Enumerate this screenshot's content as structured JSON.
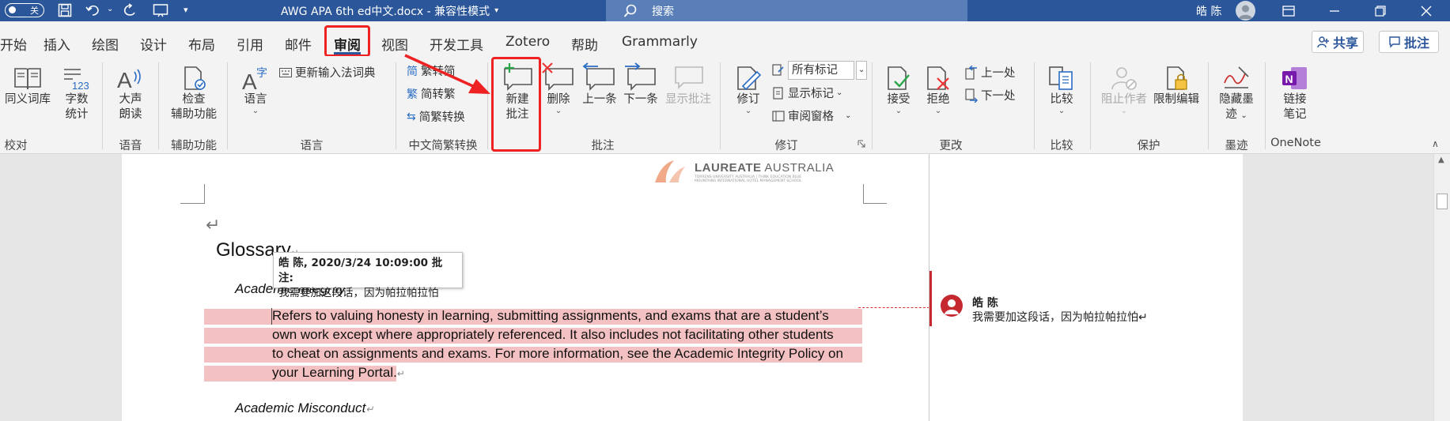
{
  "window": {
    "autosave_label": "关",
    "doc_title": "AWG APA 6th ed中文.docx  -  兼容性模式",
    "search_placeholder": "搜索",
    "user_name": "皓 陈"
  },
  "tabs": [
    "开始",
    "插入",
    "绘图",
    "设计",
    "布局",
    "引用",
    "邮件",
    "审阅",
    "视图",
    "开发工具",
    "Zotero",
    "帮助",
    "Grammarly"
  ],
  "active_tab": "审阅",
  "top_right": {
    "share": "共享",
    "comments": "批注"
  },
  "ribbon": {
    "proofing": {
      "thesaurus": "同义词库",
      "word_count": [
        "字数",
        "统计"
      ],
      "label": "校对"
    },
    "speech": {
      "read_aloud": [
        "大声",
        "朗读"
      ],
      "label": "语音"
    },
    "accessibility": {
      "check": [
        "检查",
        "辅助功能"
      ],
      "label": "辅助功能"
    },
    "language": {
      "language_btn": "语言",
      "update_ime": "更新输入法词典",
      "label": "语言"
    },
    "chinese": {
      "to_trad": "繁转简",
      "to_simp": "简转繁",
      "convert": "简繁转换",
      "label": "中文简繁转换",
      "icon_simp": "简",
      "icon_trad": "繁"
    },
    "comments": {
      "new": [
        "新建",
        "批注"
      ],
      "delete": "删除",
      "previous": "上一条",
      "next": "下一条",
      "show": "显示批注",
      "label": "批注"
    },
    "tracking": {
      "track": "修订",
      "markup_value": "所有标记",
      "show_markup": "显示标记",
      "reviewing_pane": "审阅窗格",
      "label": "修订"
    },
    "changes": {
      "accept": "接受",
      "reject": "拒绝",
      "prev": "上一处",
      "next": "下一处",
      "label": "更改"
    },
    "compare": {
      "compare": "比较",
      "label": "比较"
    },
    "protect": {
      "block_authors": "阻止作者",
      "restrict": "限制编辑",
      "label": "保护"
    },
    "ink": {
      "hide_ink": [
        "隐藏墨",
        "迹"
      ],
      "label": "墨迹"
    },
    "onenote": {
      "linked_notes": [
        "链接",
        "笔记"
      ],
      "label": "OneNote",
      "icon_letter": "N"
    }
  },
  "document": {
    "logo": {
      "bold": "LAUREATE",
      "rest": " AUSTRALIA",
      "sub": "TORRENS UNIVERSITY AUSTRALIA | THINK EDUCATION BLUE MOUNTAINS INTERNATIONAL HOTEL MANAGEMENT SCHOOL"
    },
    "heading": "Glossary",
    "subheading_1": "Academic Integrity",
    "paragraph_lines": [
      "Refers to valuing honesty in learning, submitting assignments, and exams that are a student’s",
      "own work except where appropriately referenced. It also includes not facilitating other students",
      "to cheat on assignments and exams. For more information, see the Academic Integrity Policy on",
      "your Learning Portal."
    ],
    "subheading_2": "Academic Misconduct",
    "return_mark": "↵",
    "para_mark": "↵"
  },
  "tooltip": {
    "header": "皓 陈, 2020/3/24 10:09:00 批注:",
    "body": "我需要加这段话，因为帕拉帕拉怕"
  },
  "comment": {
    "author": "皓 陈",
    "text": "我需要加这段话，因为帕拉帕拉怕↵"
  },
  "colors": {
    "accent": "#2b579a",
    "highlight": "#f3c1c2",
    "annotation_red": "#e22222",
    "comment_red": "#c5282f"
  }
}
